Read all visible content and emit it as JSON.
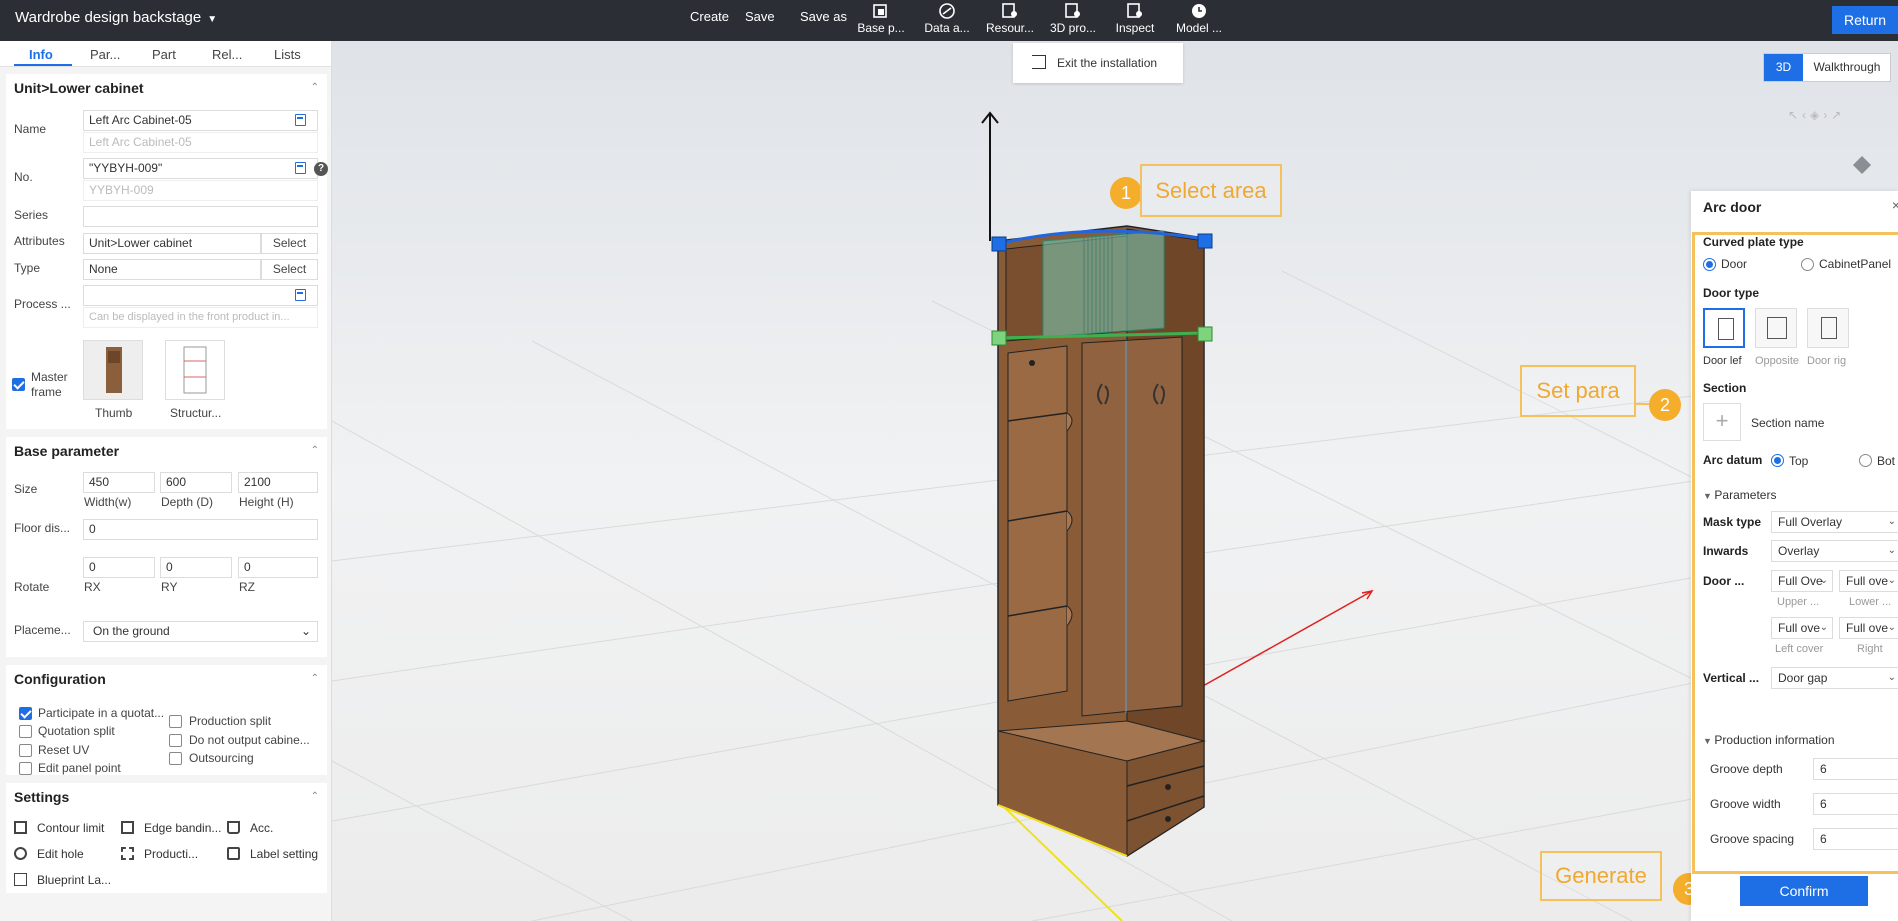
{
  "topbar": {
    "title": "Wardrobe design backstage",
    "create": "Create",
    "save": "Save",
    "save_as": "Save as",
    "tools": [
      {
        "label": "Base p..."
      },
      {
        "label": "Data a..."
      },
      {
        "label": "Resour..."
      },
      {
        "label": "3D pro..."
      },
      {
        "label": "Inspect"
      },
      {
        "label": "Model ..."
      }
    ],
    "return": "Return"
  },
  "left": {
    "tabs": [
      "Info",
      "Par...",
      "Part",
      "Rel...",
      "Lists"
    ],
    "info": {
      "heading": "Unit>Lower cabinet",
      "name_label": "Name",
      "name_value": "Left Arc Cabinet-05",
      "name_sub": "Left Arc Cabinet-05",
      "no_label": "No.",
      "no_value": "\"YYBYH-009\"",
      "no_sub": "YYBYH-009",
      "series_label": "Series",
      "attributes_label": "Attributes",
      "attributes_value": "Unit>Lower cabinet",
      "type_label": "Type",
      "type_value": "None",
      "select": "Select",
      "process_label": "Process ...",
      "process_placeholder": "Can be displayed in the front product in...",
      "master_frame": "Master frame",
      "thumb": "Thumb",
      "structure": "Structur..."
    },
    "base": {
      "heading": "Base parameter",
      "size_label": "Size",
      "width": "450",
      "depth": "600",
      "height": "2100",
      "width_label": "Width(w)",
      "depth_label": "Depth (D)",
      "height_label": "Height (H)",
      "floor_label": "Floor dis...",
      "floor_value": "0",
      "rotate_label": "Rotate",
      "rx": "0",
      "ry": "0",
      "rz": "0",
      "rx_label": "RX",
      "ry_label": "RY",
      "rz_label": "RZ",
      "placement_label": "Placeme...",
      "placement_value": "On the ground"
    },
    "config": {
      "heading": "Configuration",
      "items": [
        {
          "label": "Participate in a quotat...",
          "checked": true
        },
        {
          "label": "Quotation split",
          "checked": false
        },
        {
          "label": "Reset UV",
          "checked": false
        },
        {
          "label": "Edit panel point",
          "checked": false
        },
        {
          "label": "Production split",
          "checked": false
        },
        {
          "label": "Do not output cabine...",
          "checked": false
        },
        {
          "label": "Outsourcing",
          "checked": false
        }
      ]
    },
    "settings": {
      "heading": "Settings",
      "items": [
        "Contour limit",
        "Edge bandin...",
        "Acc.",
        "Edit hole",
        "Producti...",
        "Label setting",
        "Blueprint La..."
      ]
    }
  },
  "viewport": {
    "exit": "Exit the installation",
    "view_3d": "3D",
    "view_walk": "Walkthrough"
  },
  "annotations": [
    {
      "num": "1",
      "label": "Select area"
    },
    {
      "num": "2",
      "label": "Set para"
    },
    {
      "num": "3",
      "label": "Generate"
    }
  ],
  "arc_door": {
    "title": "Arc door",
    "curved_label": "Curved plate type",
    "opt_door": "Door",
    "opt_cabinet": "CabinetPanel",
    "door_type_label": "Door type",
    "door_types": [
      "Door lef",
      "Opposite",
      "Door rig"
    ],
    "section_label": "Section",
    "section_name": "Section name",
    "arc_datum_label": "Arc datum",
    "opt_top": "Top",
    "opt_bot": "Bot",
    "parameters": "Parameters",
    "mask_type_label": "Mask type",
    "mask_type": "Full Overlay",
    "inwards_label": "Inwards",
    "inwards": "Overlay",
    "door_label": "Door ...",
    "upper_val": "Full Ove",
    "lower_val": "Full ove",
    "upper_label": "Upper ...",
    "lower_label": "Lower ...",
    "left_val": "Full ove",
    "right_val": "Full ove",
    "left_label": "Left cover",
    "right_label": "Right",
    "vertical_label": "Vertical ...",
    "vertical": "Door gap",
    "production": "Production information",
    "groove_depth_label": "Groove depth",
    "groove_depth": "6",
    "groove_width_label": "Groove width",
    "groove_width": "6",
    "groove_spacing_label": "Groove spacing",
    "groove_spacing": "6",
    "confirm": "Confirm"
  }
}
